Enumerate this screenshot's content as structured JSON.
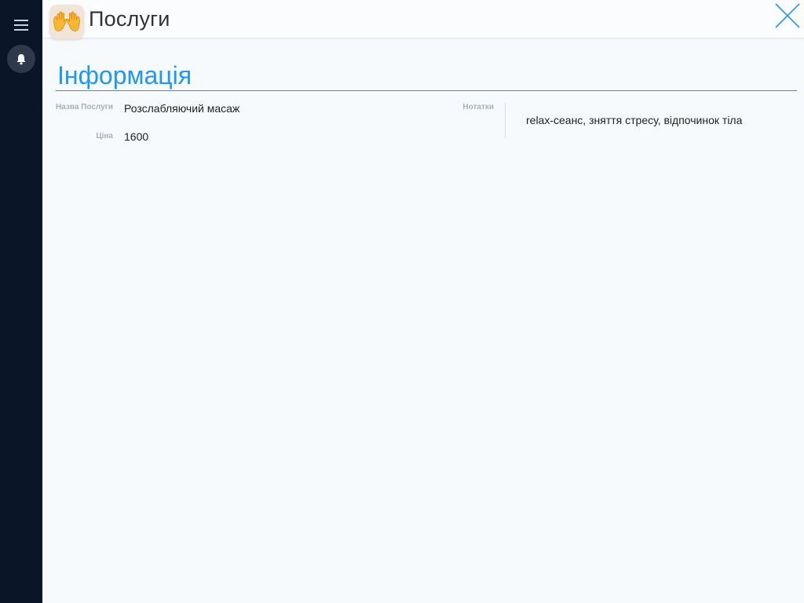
{
  "header": {
    "title": "Послуги",
    "icon": "raised-hands-icon"
  },
  "sidebar": {
    "menu_icon": "hamburger-menu-icon",
    "notifications_icon": "bell-icon"
  },
  "section": {
    "title": "Інформація"
  },
  "fields": {
    "service_name": {
      "label": "Назва Послуги",
      "value": "Розслабляючий масаж"
    },
    "price": {
      "label": "Ціна",
      "value": "1600"
    },
    "notes": {
      "label": "Нотатки",
      "value": "relax-сеанс, зняття стресу, відпочинок тіла"
    }
  },
  "colors": {
    "accent": "#2196f3",
    "sidebar": "#0b1528",
    "background": "#f7fafc"
  }
}
